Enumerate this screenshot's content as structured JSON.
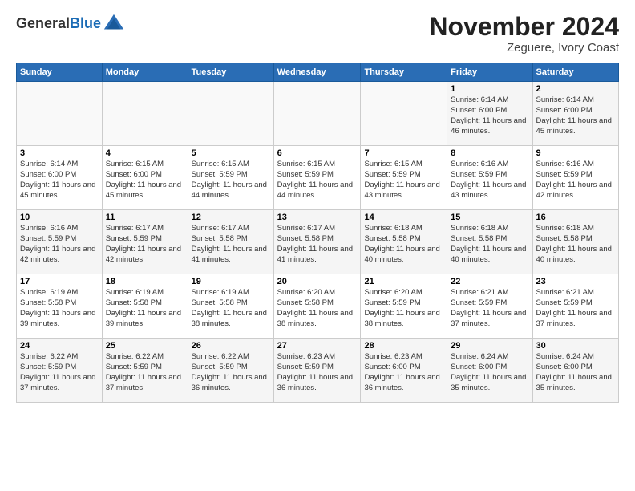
{
  "header": {
    "logo_line1": "General",
    "logo_line2": "Blue",
    "month": "November 2024",
    "location": "Zeguere, Ivory Coast"
  },
  "days_of_week": [
    "Sunday",
    "Monday",
    "Tuesday",
    "Wednesday",
    "Thursday",
    "Friday",
    "Saturday"
  ],
  "weeks": [
    [
      {
        "day": "",
        "info": ""
      },
      {
        "day": "",
        "info": ""
      },
      {
        "day": "",
        "info": ""
      },
      {
        "day": "",
        "info": ""
      },
      {
        "day": "",
        "info": ""
      },
      {
        "day": "1",
        "info": "Sunrise: 6:14 AM\nSunset: 6:00 PM\nDaylight: 11 hours and 46 minutes."
      },
      {
        "day": "2",
        "info": "Sunrise: 6:14 AM\nSunset: 6:00 PM\nDaylight: 11 hours and 45 minutes."
      }
    ],
    [
      {
        "day": "3",
        "info": "Sunrise: 6:14 AM\nSunset: 6:00 PM\nDaylight: 11 hours and 45 minutes."
      },
      {
        "day": "4",
        "info": "Sunrise: 6:15 AM\nSunset: 6:00 PM\nDaylight: 11 hours and 45 minutes."
      },
      {
        "day": "5",
        "info": "Sunrise: 6:15 AM\nSunset: 5:59 PM\nDaylight: 11 hours and 44 minutes."
      },
      {
        "day": "6",
        "info": "Sunrise: 6:15 AM\nSunset: 5:59 PM\nDaylight: 11 hours and 44 minutes."
      },
      {
        "day": "7",
        "info": "Sunrise: 6:15 AM\nSunset: 5:59 PM\nDaylight: 11 hours and 43 minutes."
      },
      {
        "day": "8",
        "info": "Sunrise: 6:16 AM\nSunset: 5:59 PM\nDaylight: 11 hours and 43 minutes."
      },
      {
        "day": "9",
        "info": "Sunrise: 6:16 AM\nSunset: 5:59 PM\nDaylight: 11 hours and 42 minutes."
      }
    ],
    [
      {
        "day": "10",
        "info": "Sunrise: 6:16 AM\nSunset: 5:59 PM\nDaylight: 11 hours and 42 minutes."
      },
      {
        "day": "11",
        "info": "Sunrise: 6:17 AM\nSunset: 5:59 PM\nDaylight: 11 hours and 42 minutes."
      },
      {
        "day": "12",
        "info": "Sunrise: 6:17 AM\nSunset: 5:58 PM\nDaylight: 11 hours and 41 minutes."
      },
      {
        "day": "13",
        "info": "Sunrise: 6:17 AM\nSunset: 5:58 PM\nDaylight: 11 hours and 41 minutes."
      },
      {
        "day": "14",
        "info": "Sunrise: 6:18 AM\nSunset: 5:58 PM\nDaylight: 11 hours and 40 minutes."
      },
      {
        "day": "15",
        "info": "Sunrise: 6:18 AM\nSunset: 5:58 PM\nDaylight: 11 hours and 40 minutes."
      },
      {
        "day": "16",
        "info": "Sunrise: 6:18 AM\nSunset: 5:58 PM\nDaylight: 11 hours and 40 minutes."
      }
    ],
    [
      {
        "day": "17",
        "info": "Sunrise: 6:19 AM\nSunset: 5:58 PM\nDaylight: 11 hours and 39 minutes."
      },
      {
        "day": "18",
        "info": "Sunrise: 6:19 AM\nSunset: 5:58 PM\nDaylight: 11 hours and 39 minutes."
      },
      {
        "day": "19",
        "info": "Sunrise: 6:19 AM\nSunset: 5:58 PM\nDaylight: 11 hours and 38 minutes."
      },
      {
        "day": "20",
        "info": "Sunrise: 6:20 AM\nSunset: 5:58 PM\nDaylight: 11 hours and 38 minutes."
      },
      {
        "day": "21",
        "info": "Sunrise: 6:20 AM\nSunset: 5:59 PM\nDaylight: 11 hours and 38 minutes."
      },
      {
        "day": "22",
        "info": "Sunrise: 6:21 AM\nSunset: 5:59 PM\nDaylight: 11 hours and 37 minutes."
      },
      {
        "day": "23",
        "info": "Sunrise: 6:21 AM\nSunset: 5:59 PM\nDaylight: 11 hours and 37 minutes."
      }
    ],
    [
      {
        "day": "24",
        "info": "Sunrise: 6:22 AM\nSunset: 5:59 PM\nDaylight: 11 hours and 37 minutes."
      },
      {
        "day": "25",
        "info": "Sunrise: 6:22 AM\nSunset: 5:59 PM\nDaylight: 11 hours and 37 minutes."
      },
      {
        "day": "26",
        "info": "Sunrise: 6:22 AM\nSunset: 5:59 PM\nDaylight: 11 hours and 36 minutes."
      },
      {
        "day": "27",
        "info": "Sunrise: 6:23 AM\nSunset: 5:59 PM\nDaylight: 11 hours and 36 minutes."
      },
      {
        "day": "28",
        "info": "Sunrise: 6:23 AM\nSunset: 6:00 PM\nDaylight: 11 hours and 36 minutes."
      },
      {
        "day": "29",
        "info": "Sunrise: 6:24 AM\nSunset: 6:00 PM\nDaylight: 11 hours and 35 minutes."
      },
      {
        "day": "30",
        "info": "Sunrise: 6:24 AM\nSunset: 6:00 PM\nDaylight: 11 hours and 35 minutes."
      }
    ]
  ]
}
